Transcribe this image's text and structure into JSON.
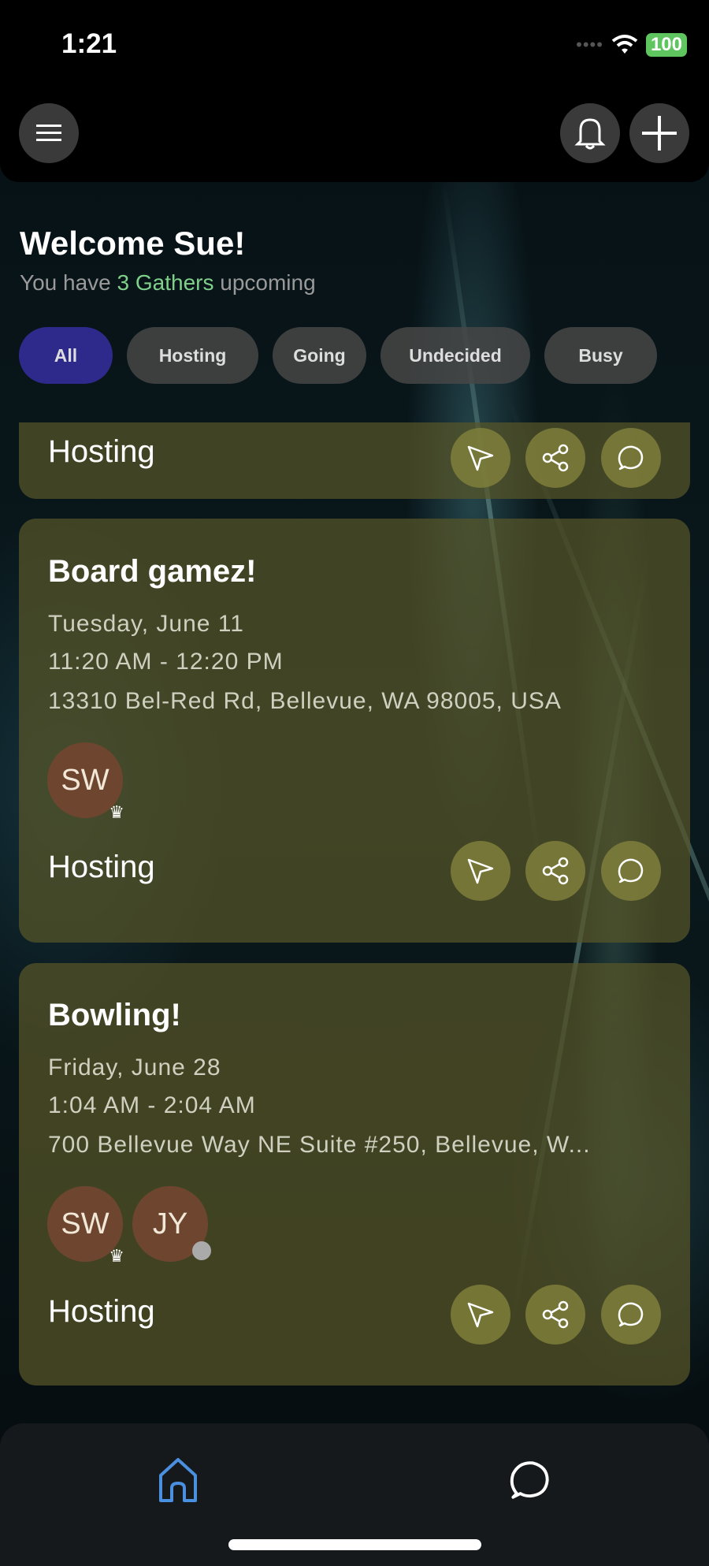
{
  "status_bar": {
    "time": "1:21",
    "battery": "100"
  },
  "header": {
    "menu_icon": "hamburger-icon",
    "bell_icon": "bell-icon",
    "add_icon": "plus-icon"
  },
  "welcome": {
    "title": "Welcome Sue!",
    "sub_prefix": "You have ",
    "sub_highlight": "3 Gathers",
    "sub_suffix": " upcoming",
    "highlight_color": "#7fd08a"
  },
  "filters": [
    {
      "label": "All",
      "active": true
    },
    {
      "label": "Hosting"
    },
    {
      "label": "Going"
    },
    {
      "label": "Undecided"
    },
    {
      "label": "Busy"
    }
  ],
  "events": [
    {
      "status": "Hosting"
    },
    {
      "title": "Board gamez!",
      "date": "Tuesday, June 11",
      "time": "11:20 AM - 12:20 PM",
      "address": "13310 Bel-Red Rd, Bellevue, WA 98005, USA",
      "attendees": [
        {
          "initials": "SW",
          "host": true
        }
      ],
      "status": "Hosting"
    },
    {
      "title": "Bowling!",
      "date": "Friday, June 28",
      "time": "1:04 AM - 2:04 AM",
      "address": "700 Bellevue Way NE Suite #250, Bellevue, W...",
      "attendees": [
        {
          "initials": "SW",
          "host": true
        },
        {
          "initials": "JY",
          "pending": true
        }
      ],
      "status": "Hosting"
    }
  ],
  "bottom_nav": [
    {
      "icon": "home-icon",
      "active": true,
      "color": "#4a8fe0"
    },
    {
      "icon": "chat-icon"
    }
  ]
}
